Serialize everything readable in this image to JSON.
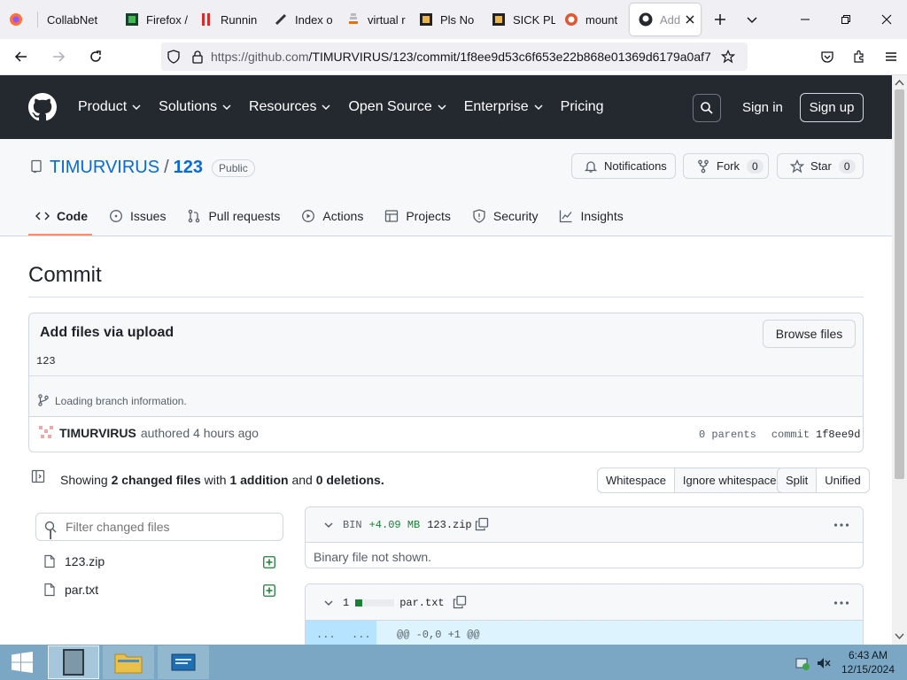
{
  "browser": {
    "tabs": [
      {
        "label": "",
        "icon": "firefox-icon"
      },
      {
        "label": "CollabNet",
        "icon": ""
      },
      {
        "label": "Firefox /",
        "icon": "green-square-icon"
      },
      {
        "label": "Runnin",
        "icon": "red-bars-icon"
      },
      {
        "label": "Index o",
        "icon": "puzzle-icon"
      },
      {
        "label": "virtual r",
        "icon": "stack-icon"
      },
      {
        "label": "Pls No",
        "icon": "dark-square-icon"
      },
      {
        "label": "SICK PL",
        "icon": "dark-square-icon"
      },
      {
        "label": "mount",
        "icon": "duckduckgo-icon"
      },
      {
        "label": "Add",
        "icon": "github-icon"
      }
    ],
    "url_host": "https://github.com",
    "url_path": "/TIMURVIRUS/123/commit/1f8ee9d53c6f653e22b868e01369d6179a0af7"
  },
  "github": {
    "nav": [
      "Product",
      "Solutions",
      "Resources",
      "Open Source",
      "Enterprise",
      "Pricing"
    ],
    "sign_in": "Sign in",
    "sign_up": "Sign up"
  },
  "repo": {
    "owner": "TIMURVIRUS",
    "separator": "/",
    "name": "123",
    "visibility": "Public",
    "notifications": "Notifications",
    "fork": "Fork",
    "fork_count": "0",
    "star": "Star",
    "star_count": "0",
    "tabs": [
      "Code",
      "Issues",
      "Pull requests",
      "Actions",
      "Projects",
      "Security",
      "Insights"
    ]
  },
  "commit": {
    "heading": "Commit",
    "title": "Add files via upload",
    "description": "123",
    "browse_files": "Browse files",
    "branch_info": "Loading branch information.",
    "author": "TIMURVIRUS",
    "authored": "authored 4 hours ago",
    "parents": "0 parents",
    "commit_label": "commit",
    "sha": "1f8ee9d"
  },
  "summary": {
    "showing": "Showing",
    "changed_files": "2 changed files",
    "with": "with",
    "additions": "1 addition",
    "and": "and",
    "deletions": "0 deletions.",
    "whitespace": "Whitespace",
    "ignore_whitespace": "Ignore whitespace",
    "split": "Split",
    "unified": "Unified"
  },
  "filter": {
    "placeholder": "Filter changed files"
  },
  "files": [
    {
      "name": "123.zip"
    },
    {
      "name": "par.txt"
    }
  ],
  "diff1": {
    "bin": "BIN",
    "size": "+4.09 MB",
    "name": "123.zip",
    "note": "Binary file not shown."
  },
  "diff2": {
    "lines": "1",
    "name": "par.txt",
    "hunk": "@@ -0,0 +1 @@",
    "expand_left": "...",
    "expand_right": "..."
  },
  "taskbar": {
    "time": "6:43 AM",
    "date": "12/15/2024"
  },
  "colors": {
    "github_header": "#24292f",
    "accent_blue": "#0969da",
    "add_green": "#1a7f37",
    "tab_underline": "#fd8c73"
  }
}
